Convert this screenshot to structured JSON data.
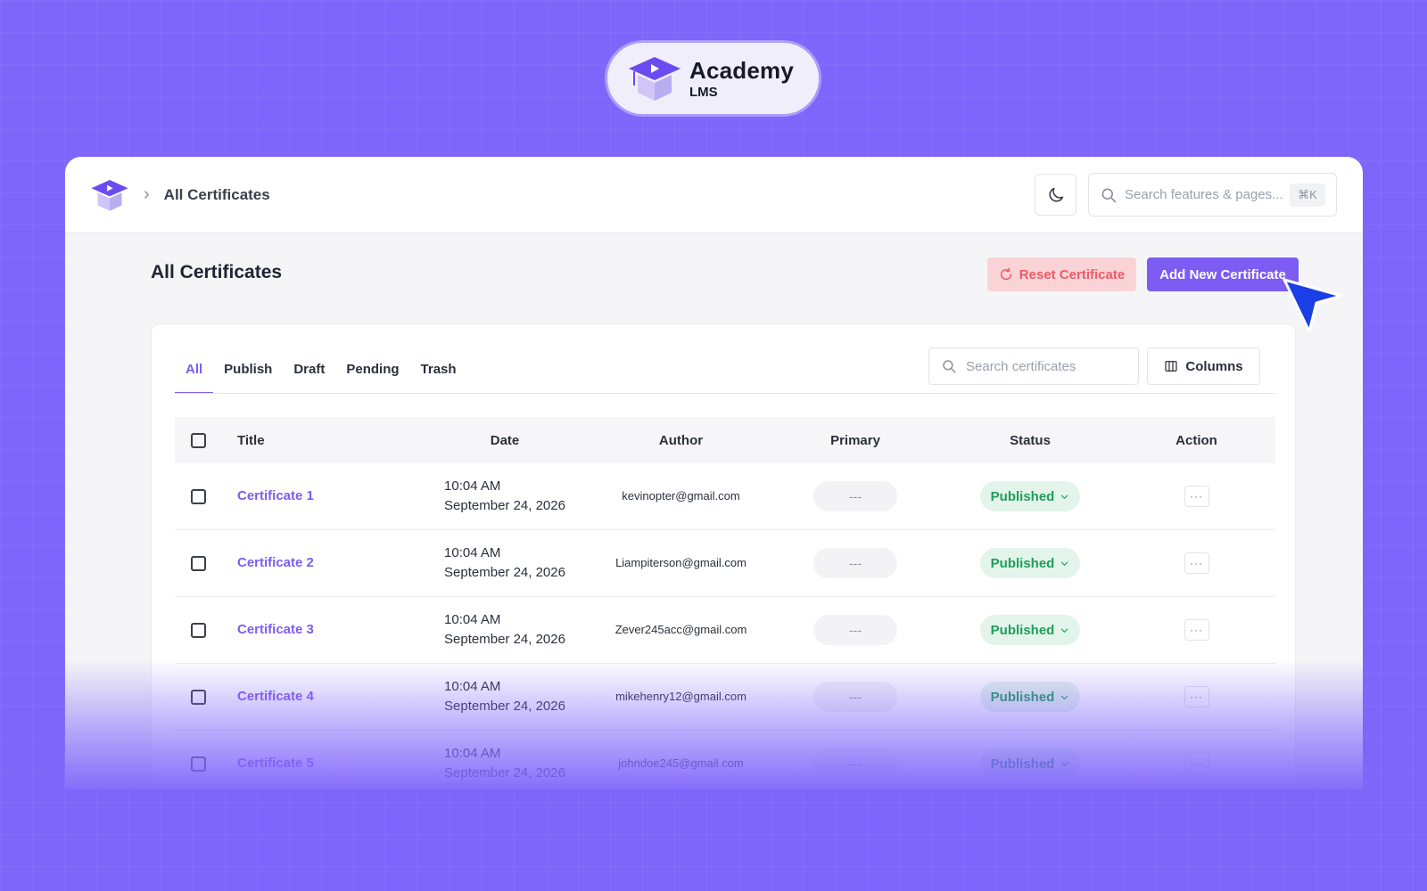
{
  "brand": {
    "name": "Academy",
    "sub": "LMS"
  },
  "topbar": {
    "breadcrumb": "All Certificates",
    "search_placeholder": "Search features & pages...",
    "shortcut": "⌘K",
    "theme_icon": "moon-icon"
  },
  "page": {
    "title": "All Certificates",
    "reset_label": "Reset Certificate",
    "add_label": "Add New Certificate"
  },
  "tabs": [
    "All",
    "Publish",
    "Draft",
    "Pending",
    "Trash"
  ],
  "active_tab": "All",
  "toolbar": {
    "search_placeholder": "Search certificates",
    "columns_label": "Columns"
  },
  "table": {
    "headers": [
      "Title",
      "Date",
      "Author",
      "Primary",
      "Status",
      "Action"
    ],
    "rows": [
      {
        "title": "Certificate 1",
        "time": "10:04 AM",
        "date": "September 24, 2026",
        "author": "kevinopter@gmail.com",
        "primary": "---",
        "status": "Published",
        "action": "···"
      },
      {
        "title": "Certificate 2",
        "time": "10:04 AM",
        "date": "September 24, 2026",
        "author": "Liampiterson@gmail.com",
        "primary": "---",
        "status": "Published",
        "action": "···"
      },
      {
        "title": "Certificate 3",
        "time": "10:04 AM",
        "date": "September 24, 2026",
        "author": "Zever245acc@gmail.com",
        "primary": "---",
        "status": "Published",
        "action": "···"
      },
      {
        "title": "Certificate 4",
        "time": "10:04 AM",
        "date": "September 24, 2026",
        "author": "mikehenry12@gmail.com",
        "primary": "---",
        "status": "Published",
        "action": "···"
      },
      {
        "title": "Certificate 5",
        "time": "10:04 AM",
        "date": "September 24, 2026",
        "author": "johndoe245@gmail.com",
        "primary": "---",
        "status": "Published",
        "action": "···"
      }
    ]
  },
  "colors": {
    "background": "#7f66fb",
    "accent": "#7c5cf2",
    "danger": "#ef5a68",
    "success": "#1e9e5a"
  }
}
